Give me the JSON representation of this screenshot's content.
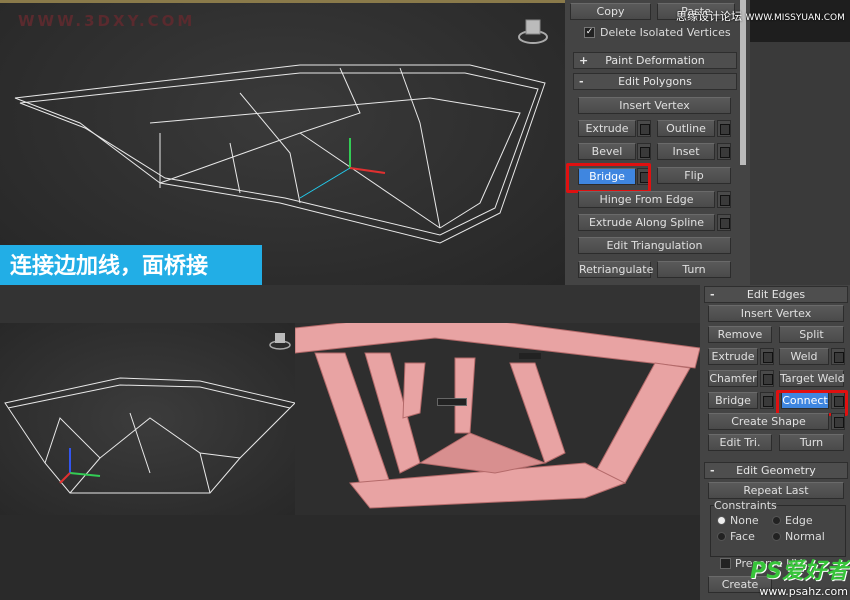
{
  "watermarks": {
    "top_left": "WWW.3DXY.COM",
    "top_right_cn": "思缘设计论坛",
    "top_right_url": "WWW.MISSYUAN.COM",
    "bottom_right_logo": "PS爱好者",
    "bottom_right_url": "www.psahz.com"
  },
  "caption": "连接边加线，面桥接",
  "colors": {
    "caption_bg": "#22aee6",
    "highlight": "#3f86e0",
    "callout": "#e01010",
    "mesh": "#e8a3a3"
  },
  "top_panel": {
    "copy": "Copy",
    "paste": "Paste",
    "delete_isolated": {
      "label": "Delete Isolated Vertices",
      "checked": true
    },
    "paint_deformation": {
      "sign": "+",
      "title": "Paint Deformation"
    },
    "edit_polygons": {
      "sign": "-",
      "title": "Edit Polygons",
      "buttons": {
        "insert_vertex": "Insert Vertex",
        "extrude": "Extrude",
        "outline": "Outline",
        "bevel": "Bevel",
        "inset": "Inset",
        "bridge": "Bridge",
        "flip": "Flip",
        "hinge": "Hinge From Edge",
        "extrude_spline": "Extrude Along Spline",
        "edit_tri": "Edit Triangulation",
        "retriangulate": "Retriangulate",
        "turn": "Turn"
      }
    }
  },
  "bottom_panel": {
    "edit_edges": {
      "sign": "-",
      "title": "Edit Edges",
      "buttons": {
        "insert_vertex": "Insert Vertex",
        "remove": "Remove",
        "split": "Split",
        "extrude": "Extrude",
        "weld": "Weld",
        "chamfer": "Chamfer",
        "target_weld": "Target Weld",
        "bridge": "Bridge",
        "connect": "Connect",
        "create_shape": "Create Shape",
        "edit_tri": "Edit Tri.",
        "turn": "Turn"
      }
    },
    "edit_geometry": {
      "sign": "-",
      "title": "Edit Geometry",
      "repeat_last": "Repeat Last",
      "constraints": {
        "title": "Constraints",
        "options": [
          "None",
          "Edge",
          "Face",
          "Normal"
        ],
        "selected": "None"
      },
      "preserve_uvs": "Preserve UVs",
      "create": "Create"
    }
  }
}
